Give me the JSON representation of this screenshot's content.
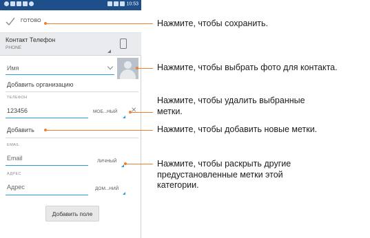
{
  "status_bar": {
    "time": "10:53"
  },
  "action_bar": {
    "done_label": "ГОТОВО"
  },
  "account": {
    "name": "Контакт Телефон",
    "type": "PHONE"
  },
  "name_field": {
    "placeholder": "Имя"
  },
  "add_organization": "Добавить организацию",
  "phone_section": {
    "header": "ТЕЛЕФОН",
    "value": "123456",
    "label_type": "МОБ...НЫЙ",
    "add_label": "Добавить"
  },
  "email_section": {
    "header": "EMAIL",
    "placeholder": "Email",
    "label_type": "ЛИЧНЫЙ"
  },
  "address_section": {
    "header": "АДРЕС",
    "placeholder": "Адрес",
    "label_type": "ДОМ...НИЙ"
  },
  "add_field_button": "Добавить поле",
  "callouts": {
    "save": "Нажмите, чтобы сохранить.",
    "photo": "Нажмите, чтобы выбрать фото для контакта.",
    "delete_line1": "Нажмите, чтобы удалить выбранные",
    "delete_line2": "метки.",
    "add_label": "Нажмите, чтобы добавить новые метки.",
    "expand_line1": "Нажмите, чтобы раскрыть другие",
    "expand_line2": "предустановленные метки этой",
    "expand_line3": "категории."
  },
  "colors": {
    "status_bar": "#1f4f8a",
    "accent": "#2a9ad8",
    "leader": "#f08030"
  }
}
